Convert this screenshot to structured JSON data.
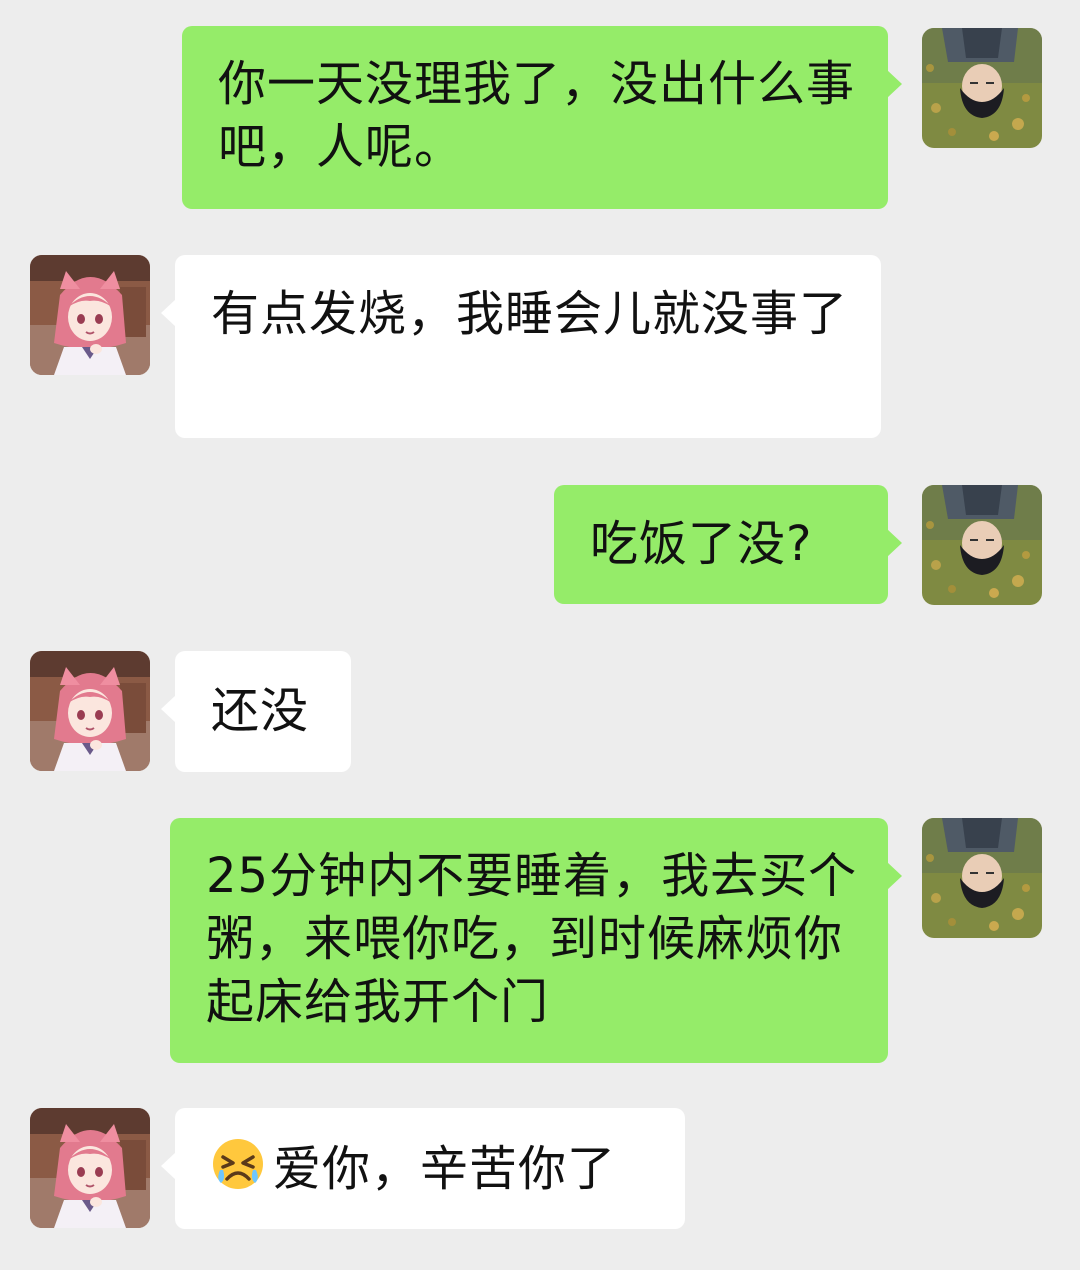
{
  "chat": {
    "messages": [
      {
        "side": "sent",
        "avatar": "boy-lying-on-grass-avatar",
        "text": "你一天没理我了，没出什么事吧，人呢。"
      },
      {
        "side": "received",
        "avatar": "anime-girl-avatar",
        "text": "有点发烧，我睡会儿就没事了"
      },
      {
        "side": "sent",
        "avatar": "boy-lying-on-grass-avatar",
        "text": "吃饭了没?"
      },
      {
        "side": "received",
        "avatar": "anime-girl-avatar",
        "text": "还没"
      },
      {
        "side": "sent",
        "avatar": "boy-lying-on-grass-avatar",
        "text": "25分钟内不要睡着，我去买个粥，来喂你吃，到时候麻烦你起床给我开个门"
      },
      {
        "side": "received",
        "avatar": "anime-girl-avatar",
        "emoji": "crying-face-emoji",
        "text": "爱你，辛苦你了"
      }
    ]
  },
  "colors": {
    "background": "#ededed",
    "sent_bubble": "#95ec69",
    "received_bubble": "#ffffff",
    "text": "#111111"
  }
}
